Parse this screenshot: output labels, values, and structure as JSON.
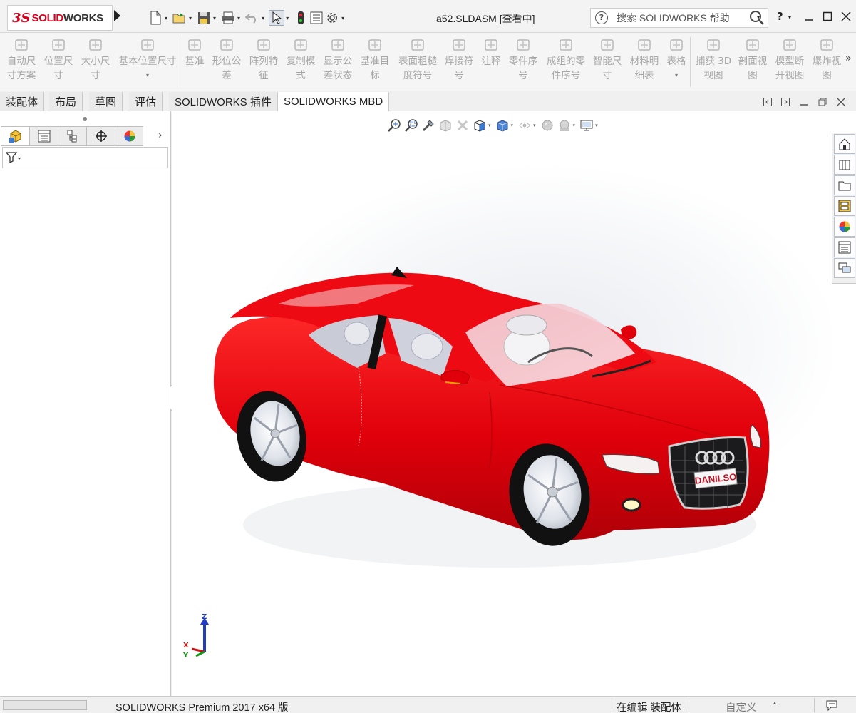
{
  "app": {
    "logo_ds": "3S",
    "logo_word_a": "SOLID",
    "logo_word_b": "WORKS",
    "document_title": "a52.SLDASM [查看中]"
  },
  "search": {
    "placeholder": "搜索 SOLIDWORKS 帮助"
  },
  "help": {
    "label": "?"
  },
  "ribbon": {
    "items": [
      {
        "label": "自动尺\n寸方案",
        "icon": "auto-dimension-icon"
      },
      {
        "label": "位置尺\n寸",
        "icon": "location-dimension-icon"
      },
      {
        "label": "大小尺\n寸",
        "icon": "size-dimension-icon"
      },
      {
        "label": "基本位置尺寸",
        "icon": "basic-location-dimension-icon",
        "dropdown": "▾"
      },
      {
        "label": "基准",
        "icon": "datum-icon"
      },
      {
        "label": "形位公\n差",
        "icon": "geometric-tolerance-icon"
      },
      {
        "label": "阵列特\n征",
        "icon": "pattern-feature-icon"
      },
      {
        "label": "复制模\n式",
        "icon": "copy-scheme-icon"
      },
      {
        "label": "显示公\n差状态",
        "icon": "show-tolerance-status-icon"
      },
      {
        "label": "基准目\n标",
        "icon": "datum-target-icon"
      },
      {
        "label": "表面粗糙\n度符号",
        "icon": "surface-finish-icon"
      },
      {
        "label": "焊接符\n号",
        "icon": "weld-symbol-icon"
      },
      {
        "label": "注释",
        "icon": "note-icon"
      },
      {
        "label": "零件序\n号",
        "icon": "balloon-icon"
      },
      {
        "label": "成组的零\n件序号",
        "icon": "stacked-balloon-icon"
      },
      {
        "label": "智能尺\n寸",
        "icon": "smart-dimension-icon"
      },
      {
        "label": "材料明\n细表",
        "icon": "bom-icon"
      },
      {
        "label": "表格",
        "icon": "table-icon",
        "dropdown": "▾"
      },
      {
        "label": "捕获 3D\n视图",
        "icon": "capture-3d-view-icon"
      },
      {
        "label": "剖面视\n图",
        "icon": "section-view-icon"
      },
      {
        "label": "模型断\n开视图",
        "icon": "model-break-view-icon"
      },
      {
        "label": "爆炸视\n图",
        "icon": "exploded-view-icon"
      }
    ],
    "more": "»"
  },
  "tabs": [
    "装配体",
    "布局",
    "草图",
    "评估",
    "SOLIDWORKS 插件",
    "SOLIDWORKS MBD"
  ],
  "active_tab": "SOLIDWORKS MBD",
  "left_panel": {
    "tabs": [
      "featuremanager-icon",
      "propertymanager-icon",
      "configurationmanager-icon",
      "dimxpertmanager-icon",
      "displaymanager-icon"
    ],
    "next": "›",
    "filter_icon": "filter-icon"
  },
  "license_plate": "DANILSO",
  "status_bar": {
    "product": "SOLIDWORKS Premium 2017 x64 版",
    "state": "在编辑 装配体",
    "units": "自定义",
    "units_dropdown": "▴"
  },
  "triad": {
    "z": "Z",
    "x": "X",
    "y": "Y"
  },
  "colors": {
    "car_body": "#e0000a",
    "brand_red": "#d9001b",
    "axis_z": "#1f3fbf",
    "axis_x": "#c81414",
    "axis_y": "#1a9a1a"
  }
}
